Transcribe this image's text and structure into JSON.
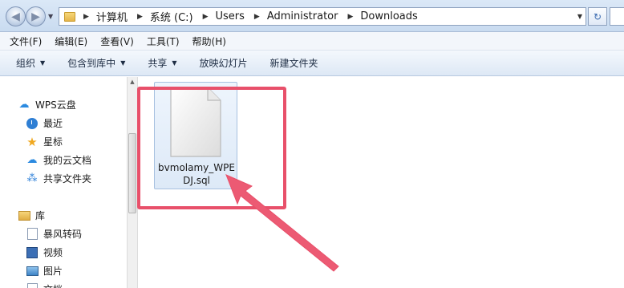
{
  "address_bar": {
    "breadcrumbs": [
      "计算机",
      "系统 (C:)",
      "Users",
      "Administrator",
      "Downloads"
    ]
  },
  "menu": [
    "文件(F)",
    "编辑(E)",
    "查看(V)",
    "工具(T)",
    "帮助(H)"
  ],
  "toolbar": {
    "organize": "组织",
    "include_in_library": "包含到库中",
    "share": "共享",
    "slideshow": "放映幻灯片",
    "new_folder": "新建文件夹"
  },
  "nav": {
    "wps_cloud": "WPS云盘",
    "recent": "最近",
    "starred": "星标",
    "my_cloud_docs": "我的云文档",
    "shared_folder": "共享文件夹",
    "libraries": "库",
    "storm_transcode": "暴风转码",
    "videos": "视频",
    "pictures": "图片",
    "documents": "文档"
  },
  "files": [
    {
      "name": "bvmolamy_WPEDJ.sql",
      "icon": "generic-file-icon"
    }
  ],
  "colors": {
    "highlight": "#e8506a",
    "accent": "#2b8ae0"
  }
}
